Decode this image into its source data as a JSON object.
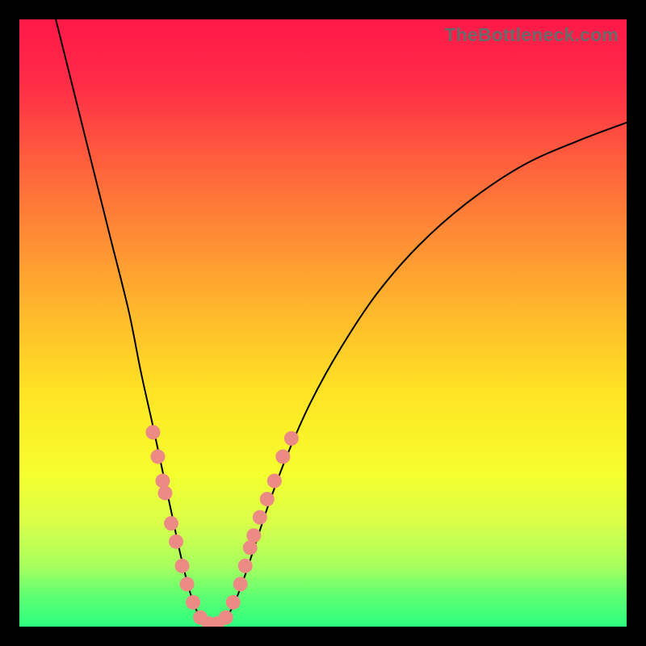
{
  "attribution": "TheBottleneck.com",
  "chart_data": {
    "type": "line",
    "title": "",
    "xlabel": "",
    "ylabel": "",
    "xlim": [
      0,
      100
    ],
    "ylim": [
      0,
      100
    ],
    "series": [
      {
        "name": "bottleneck-curve",
        "points": [
          {
            "x": 6,
            "y": 100
          },
          {
            "x": 9,
            "y": 88
          },
          {
            "x": 12,
            "y": 76
          },
          {
            "x": 15,
            "y": 64
          },
          {
            "x": 18,
            "y": 52
          },
          {
            "x": 20,
            "y": 42
          },
          {
            "x": 22,
            "y": 33
          },
          {
            "x": 23.5,
            "y": 26
          },
          {
            "x": 25,
            "y": 19
          },
          {
            "x": 26.5,
            "y": 12
          },
          {
            "x": 28,
            "y": 6
          },
          {
            "x": 29.5,
            "y": 2
          },
          {
            "x": 31,
            "y": 0.5
          },
          {
            "x": 33,
            "y": 0.5
          },
          {
            "x": 35,
            "y": 3
          },
          {
            "x": 37,
            "y": 8
          },
          {
            "x": 39,
            "y": 14
          },
          {
            "x": 41,
            "y": 20
          },
          {
            "x": 44,
            "y": 28
          },
          {
            "x": 48,
            "y": 37
          },
          {
            "x": 53,
            "y": 46
          },
          {
            "x": 59,
            "y": 55
          },
          {
            "x": 66,
            "y": 63
          },
          {
            "x": 74,
            "y": 70
          },
          {
            "x": 83,
            "y": 76
          },
          {
            "x": 92,
            "y": 80
          },
          {
            "x": 100,
            "y": 83
          }
        ]
      },
      {
        "name": "highlight-dots",
        "points": [
          {
            "x": 22.0,
            "y": 32
          },
          {
            "x": 22.8,
            "y": 28
          },
          {
            "x": 23.6,
            "y": 24
          },
          {
            "x": 24.0,
            "y": 22
          },
          {
            "x": 25.0,
            "y": 17
          },
          {
            "x": 25.8,
            "y": 14
          },
          {
            "x": 26.8,
            "y": 10
          },
          {
            "x": 27.6,
            "y": 7
          },
          {
            "x": 28.6,
            "y": 4
          },
          {
            "x": 29.8,
            "y": 1.5
          },
          {
            "x": 31.2,
            "y": 0.5
          },
          {
            "x": 32.6,
            "y": 0.5
          },
          {
            "x": 34.0,
            "y": 1.5
          },
          {
            "x": 35.2,
            "y": 4
          },
          {
            "x": 36.4,
            "y": 7
          },
          {
            "x": 37.2,
            "y": 10
          },
          {
            "x": 38.0,
            "y": 13
          },
          {
            "x": 38.6,
            "y": 15
          },
          {
            "x": 39.6,
            "y": 18
          },
          {
            "x": 40.8,
            "y": 21
          },
          {
            "x": 42.0,
            "y": 24
          },
          {
            "x": 43.4,
            "y": 28
          },
          {
            "x": 44.8,
            "y": 31
          }
        ]
      }
    ]
  }
}
